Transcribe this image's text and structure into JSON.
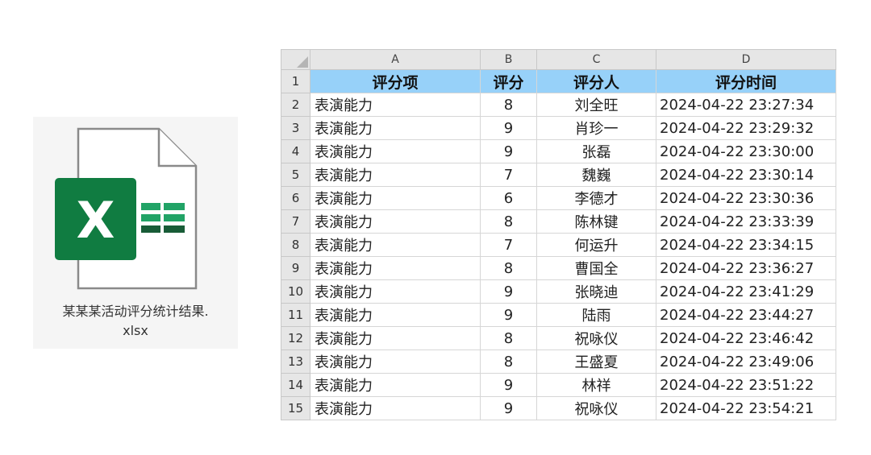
{
  "file": {
    "name_line1": "某某某活动评分统计结果.",
    "name_line2": "xlsx",
    "icon": "excel-file-icon",
    "icon_letter": "X",
    "brand_color": "#107c41"
  },
  "sheet": {
    "column_letters": [
      "A",
      "B",
      "C",
      "D"
    ],
    "header_row_number": "1",
    "headers": [
      "评分项",
      "评分",
      "评分人",
      "评分时间"
    ],
    "header_fill": "#97d1f9",
    "rows": [
      {
        "n": "2",
        "item": "表演能力",
        "score": "8",
        "rater": "刘全旺",
        "time": "2024-04-22 23:27:34"
      },
      {
        "n": "3",
        "item": "表演能力",
        "score": "9",
        "rater": "肖珍一",
        "time": "2024-04-22 23:29:32"
      },
      {
        "n": "4",
        "item": "表演能力",
        "score": "9",
        "rater": "张磊",
        "time": "2024-04-22 23:30:00"
      },
      {
        "n": "5",
        "item": "表演能力",
        "score": "7",
        "rater": "魏巍",
        "time": "2024-04-22 23:30:14"
      },
      {
        "n": "6",
        "item": "表演能力",
        "score": "6",
        "rater": "李德才",
        "time": "2024-04-22 23:30:36"
      },
      {
        "n": "7",
        "item": "表演能力",
        "score": "8",
        "rater": "陈林键",
        "time": "2024-04-22 23:33:39"
      },
      {
        "n": "8",
        "item": "表演能力",
        "score": "7",
        "rater": "何运升",
        "time": "2024-04-22 23:34:15"
      },
      {
        "n": "9",
        "item": "表演能力",
        "score": "8",
        "rater": "曹国全",
        "time": "2024-04-22 23:36:27"
      },
      {
        "n": "10",
        "item": "表演能力",
        "score": "9",
        "rater": "张晓迪",
        "time": "2024-04-22 23:41:29"
      },
      {
        "n": "11",
        "item": "表演能力",
        "score": "9",
        "rater": "陆雨",
        "time": "2024-04-22 23:44:27"
      },
      {
        "n": "12",
        "item": "表演能力",
        "score": "8",
        "rater": "祝咏仪",
        "time": "2024-04-22 23:46:42"
      },
      {
        "n": "13",
        "item": "表演能力",
        "score": "8",
        "rater": "王盛夏",
        "time": "2024-04-22 23:49:06"
      },
      {
        "n": "14",
        "item": "表演能力",
        "score": "9",
        "rater": "林祥",
        "time": "2024-04-22 23:51:22"
      },
      {
        "n": "15",
        "item": "表演能力",
        "score": "9",
        "rater": "祝咏仪",
        "time": "2024-04-22 23:54:21"
      }
    ]
  }
}
